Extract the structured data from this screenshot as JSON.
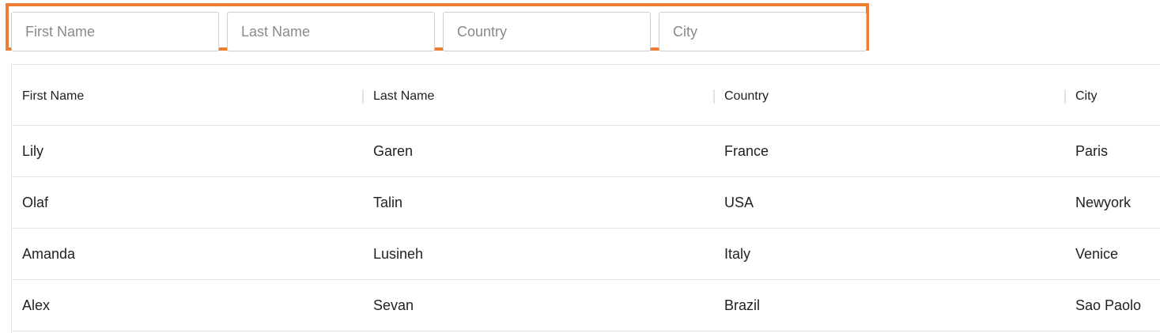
{
  "filters": {
    "first_name_placeholder": "First Name",
    "last_name_placeholder": "Last Name",
    "country_placeholder": "Country",
    "city_placeholder": "City",
    "highlight_color": "#ed7d31"
  },
  "table": {
    "columns": [
      "First Name",
      "Last Name",
      "Country",
      "City"
    ],
    "rows": [
      [
        "Lily",
        "Garen",
        "France",
        "Paris"
      ],
      [
        "Olaf",
        "Talin",
        "USA",
        "Newyork"
      ],
      [
        "Amanda",
        "Lusineh",
        "Italy",
        "Venice"
      ],
      [
        "Alex",
        "Sevan",
        "Brazil",
        "Sao Paolo"
      ]
    ]
  }
}
